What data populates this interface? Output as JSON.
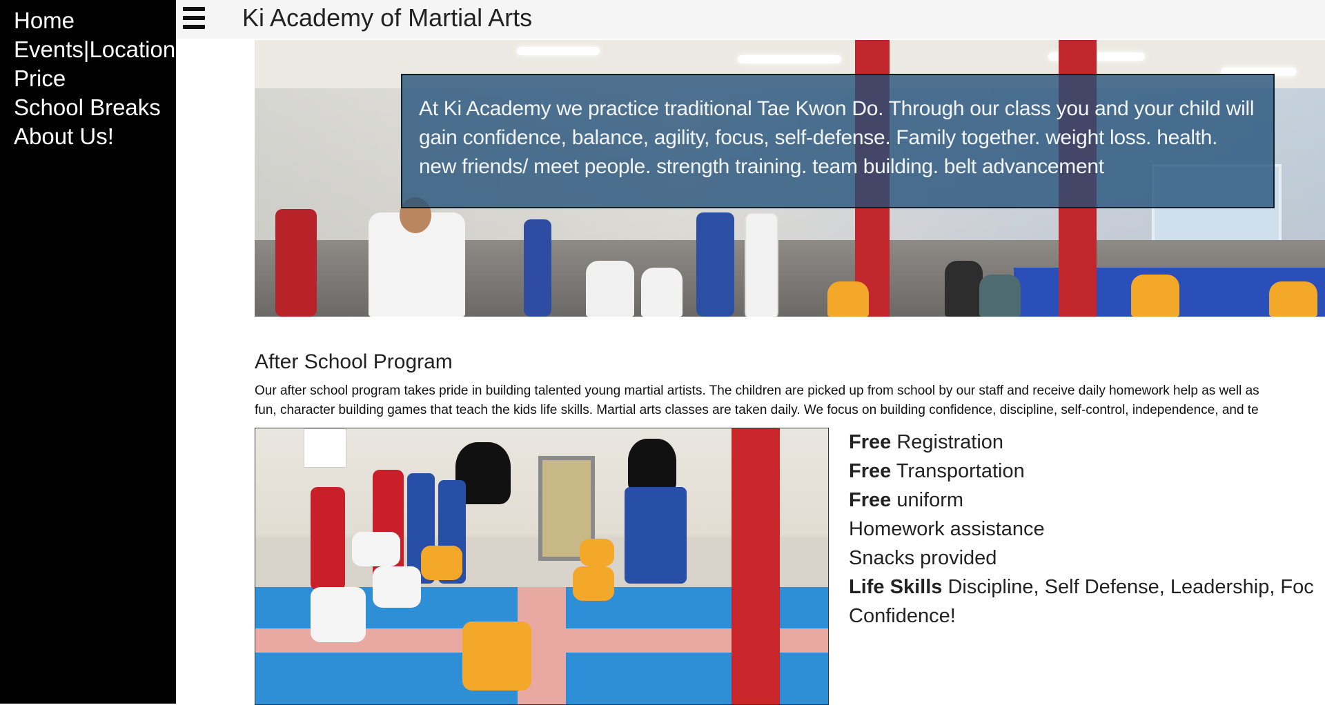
{
  "sidebar": {
    "items": [
      {
        "label": "Home"
      },
      {
        "label": "Events|Locations"
      },
      {
        "label": "Price"
      },
      {
        "label": "School Breaks"
      },
      {
        "label": "About Us!"
      }
    ]
  },
  "header": {
    "title": "Ki Academy of Martial Arts"
  },
  "hero": {
    "caption": "At Ki Academy we practice traditional Tae Kwon Do. Through our class you and your child will gain confidence, balance, agility, focus, self-defense. Family together. weight loss. health. new friends/ meet people. strength training. team building. belt advancement"
  },
  "after_school": {
    "heading": "After School Program",
    "paragraph_line1": "Our after school program takes pride in building talented young martial artists. The children are picked up from school by our staff and receive daily homework help as well as",
    "paragraph_line2": "fun, character building games that teach the kids life skills. Martial arts classes are taken daily. We focus on building confidence, discipline, self-control, independence, and te",
    "features": [
      {
        "bold": "Free",
        "text": " Registration"
      },
      {
        "bold": "Free",
        "text": " Transportation"
      },
      {
        "bold": "Free",
        "text": " uniform"
      },
      {
        "bold": "",
        "text": "Homework assistance"
      },
      {
        "bold": "",
        "text": "Snacks provided"
      },
      {
        "bold": "Life Skills",
        "text": " Discipline, Self Defense, Leadership, Foc"
      },
      {
        "bold": "",
        "text": "Confidence!"
      }
    ]
  },
  "colors": {
    "sidebar_bg": "#000000",
    "topbar_bg": "#f5f5f5",
    "caption_bg": "#215078"
  },
  "icons": {
    "menu": "hamburger-menu-icon"
  }
}
